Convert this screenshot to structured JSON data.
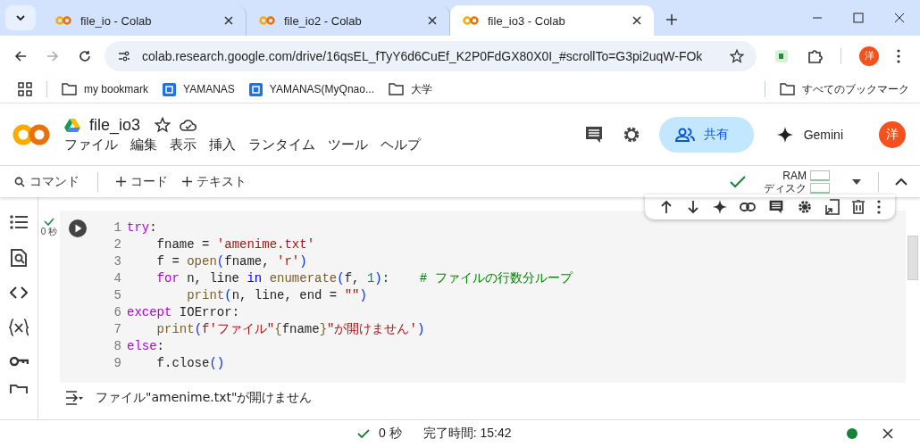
{
  "browser": {
    "tabs": [
      {
        "title": "file_io - Colab",
        "selected": false
      },
      {
        "title": "file_io2 - Colab",
        "selected": false
      },
      {
        "title": "file_io3 - Colab",
        "selected": true
      }
    ],
    "url": "colab.research.google.com/drive/16qsEL_fTyY6d6CuEf_K2P0FdGX80X0I_#scrollTo=G3pi2uqW-FOk",
    "profile": "洋",
    "bookmarks": [
      {
        "kind": "folder",
        "label": "my bookmark"
      },
      {
        "kind": "site",
        "label": "YAMANAS"
      },
      {
        "kind": "site",
        "label": "YAMANAS(MyQnao..."
      },
      {
        "kind": "folder",
        "label": "大学"
      }
    ],
    "all_bookmarks": "すべてのブックマーク"
  },
  "notebook": {
    "title": "file_io3",
    "menu": [
      "ファイル",
      "編集",
      "表示",
      "挿入",
      "ランタイム",
      "ツール",
      "ヘルプ"
    ],
    "share": "共有",
    "gemini": "Gemini",
    "avatar": "洋"
  },
  "toolbar": {
    "command": "コマンド",
    "add": [
      "コード",
      "テキスト"
    ],
    "ram": "RAM",
    "disk": "ディスク"
  },
  "cell": {
    "exec_time": "0 秒",
    "lines": [
      {
        "no": "1",
        "tokens": [
          {
            "text": "try",
            "kind": "keyword"
          },
          {
            "text": ":",
            "kind": "plain"
          }
        ]
      },
      {
        "no": "2",
        "tokens": [
          {
            "text": "    fname = ",
            "kind": "plain"
          },
          {
            "text": "'amenime.txt'",
            "kind": "string"
          }
        ]
      },
      {
        "no": "3",
        "tokens": [
          {
            "text": "    f = ",
            "kind": "plain"
          },
          {
            "text": "open",
            "kind": "function"
          },
          {
            "text": "(",
            "kind": "bracket"
          },
          {
            "text": "fname, ",
            "kind": "plain"
          },
          {
            "text": "'r'",
            "kind": "string"
          },
          {
            "text": ")",
            "kind": "bracket"
          }
        ]
      },
      {
        "no": "4",
        "tokens": [
          {
            "text": "    for",
            "kind": "keyword"
          },
          {
            "text": " n, line ",
            "kind": "plain"
          },
          {
            "text": "in",
            "kind": "operator"
          },
          {
            "text": " enumerate",
            "kind": "function"
          },
          {
            "text": "(",
            "kind": "bracket"
          },
          {
            "text": "f, ",
            "kind": "plain"
          },
          {
            "text": "1",
            "kind": "number"
          },
          {
            "text": ")",
            "kind": "bracket"
          },
          {
            "text": ":    ",
            "kind": "plain"
          },
          {
            "text": "# ファイルの行数分ループ",
            "kind": "comment"
          }
        ]
      },
      {
        "no": "5",
        "tokens": [
          {
            "text": "        print",
            "kind": "function"
          },
          {
            "text": "(",
            "kind": "bracket"
          },
          {
            "text": "n, line, end = ",
            "kind": "plain"
          },
          {
            "text": "\"\"",
            "kind": "string"
          },
          {
            "text": ")",
            "kind": "bracket"
          }
        ]
      },
      {
        "no": "6",
        "tokens": [
          {
            "text": "except",
            "kind": "keyword"
          },
          {
            "text": " IOError:",
            "kind": "plain"
          }
        ]
      },
      {
        "no": "7",
        "tokens": [
          {
            "text": "    print",
            "kind": "function"
          },
          {
            "text": "(",
            "kind": "bracket"
          },
          {
            "text": "f'ファイル\"",
            "kind": "string"
          },
          {
            "text": "{",
            "kind": "function"
          },
          {
            "text": "fname",
            "kind": "plain"
          },
          {
            "text": "}",
            "kind": "function"
          },
          {
            "text": "\"が開けません'",
            "kind": "string"
          },
          {
            "text": ")",
            "kind": "bracket"
          }
        ]
      },
      {
        "no": "8",
        "tokens": [
          {
            "text": "else",
            "kind": "keyword"
          },
          {
            "text": ":",
            "kind": "plain"
          }
        ]
      },
      {
        "no": "9",
        "tokens": [
          {
            "text": "    f.close",
            "kind": "plain"
          },
          {
            "text": "()",
            "kind": "bracket"
          }
        ]
      }
    ],
    "output": "ファイル\"amenime.txt\"が開けません"
  },
  "status_bar": {
    "time": "0 秒",
    "completed": "完了時間: 15:42"
  }
}
